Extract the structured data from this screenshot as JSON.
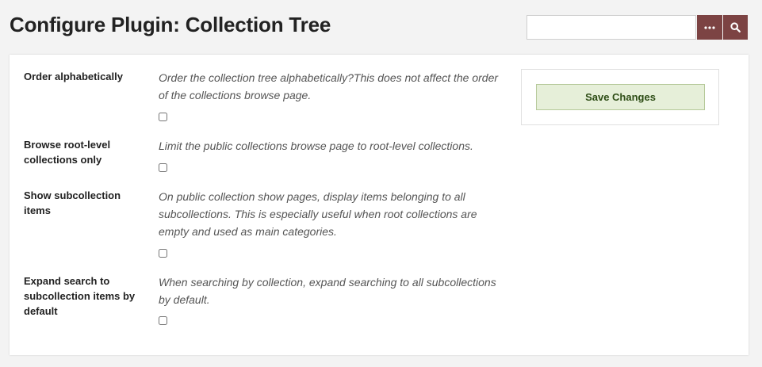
{
  "header": {
    "title": "Configure Plugin: Collection Tree"
  },
  "search": {
    "value": "",
    "placeholder": "",
    "options_icon": "ellipsis-icon",
    "submit_icon": "search-icon",
    "button_color": "#7c4343"
  },
  "form": {
    "fields": [
      {
        "label": "Order alphabetically",
        "description": "Order the collection tree alphabetically?This does not affect the order of the collections browse page.",
        "checked": false
      },
      {
        "label": "Browse root-level collections only",
        "description": "Limit the public collections browse page to root-level collections.",
        "checked": false
      },
      {
        "label": "Show subcollection items",
        "description": "On public collection show pages, display items belonging to all subcollections. This is especially useful when root collections are empty and used as main categories.",
        "checked": false
      },
      {
        "label": "Expand search to subcollection items by default",
        "description": "When searching by collection, expand searching to all subcollections by default.",
        "checked": false
      }
    ]
  },
  "sidebar": {
    "save_label": "Save Changes"
  },
  "colors": {
    "background": "#f3f3f3",
    "accent": "#7c4343",
    "save_bg": "#e6efd9",
    "save_text": "#2e4d16"
  }
}
